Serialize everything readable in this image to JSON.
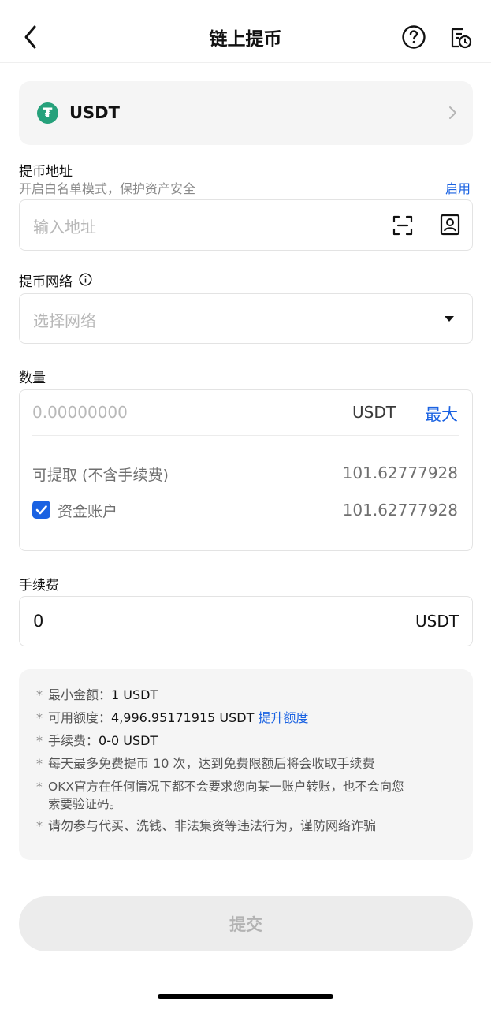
{
  "header": {
    "title": "链上提币",
    "back_icon": "chevron-left-icon",
    "help_icon": "question-circle-icon",
    "history_icon": "history-record-icon"
  },
  "coin": {
    "name": "USDT",
    "logo_glyph": "₮",
    "logo_color": "#26a17b"
  },
  "address": {
    "label": "提币地址",
    "hint": "开启白名单模式，保护资产安全",
    "enable_link": "启用",
    "placeholder": "输入地址"
  },
  "network": {
    "label": "提币网络",
    "placeholder": "选择网络"
  },
  "amount": {
    "label": "数量",
    "placeholder": "0.00000000",
    "unit": "USDT",
    "max_label": "最大",
    "available_label": "可提取 (不含手续费)",
    "available_value": "101.62777928",
    "funding_account_label": "资金账户",
    "funding_account_value": "101.62777928",
    "funding_account_checked": true
  },
  "fee": {
    "label": "手续费",
    "value": "0",
    "unit": "USDT"
  },
  "notes": {
    "min_label": "最小金额：",
    "min_value": "1 USDT",
    "limit_label": "可用额度：",
    "limit_value": "4,996.95171915 USDT",
    "limit_link": "提升额度",
    "fee_label": "手续费：",
    "fee_value": "0-0 USDT",
    "free_note": "每天最多免费提币 10 次，达到免费限额后将会收取手续费",
    "okx_note_line1": "OKX官方在任何情况下都不会要求您向某一账户转账，也不会向您",
    "okx_note_line2": "索要验证码。",
    "fraud_note": "请勿参与代买、洗钱、非法集资等违法行为，谨防网络诈骗"
  },
  "submit_label": "提交",
  "colors": {
    "accent": "#1a62e2",
    "card_bg": "#f5f5f5"
  }
}
